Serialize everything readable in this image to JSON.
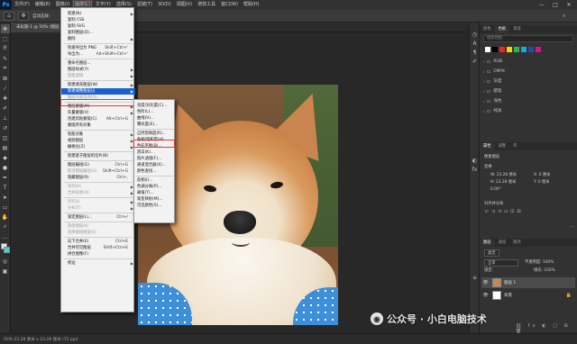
{
  "menubar": {
    "logo": "Ps",
    "items": [
      "文件(F)",
      "编辑(E)",
      "图像(I)",
      "图层(L)",
      "文字(Y)",
      "选择(S)",
      "滤镜(T)",
      "3D(D)",
      "视图(V)",
      "增效工具",
      "窗口(W)",
      "帮助(H)"
    ],
    "active_index": 3
  },
  "window_controls": {
    "minimize": "—",
    "maximize": "□",
    "close": "✕"
  },
  "options_bar": {
    "label": "自动选择："
  },
  "document_tab": {
    "label": "未标题-1 @ 50% (图层 1, RGB/8)"
  },
  "layer_menu": {
    "rows": [
      {
        "label": "新建(N)",
        "arrow": true
      },
      {
        "label": "复制 CSS"
      },
      {
        "label": "复制 SVG"
      },
      {
        "label": "复制图层(D)...",
        "disabled": false
      },
      {
        "label": "删除",
        "arrow": true
      },
      {
        "sep": true
      },
      {
        "label": "快速导出为 PNG",
        "shortcut": "Shift+Ctrl+'"
      },
      {
        "label": "导出为...",
        "shortcut": "Alt+Shift+Ctrl+'"
      },
      {
        "sep": true
      },
      {
        "label": "重命名图层..."
      },
      {
        "label": "图层样式(Y)",
        "arrow": true
      },
      {
        "label": "智能滤镜",
        "arrow": true,
        "disabled": true
      },
      {
        "sep": true
      },
      {
        "label": "新建填充图层(W)",
        "arrow": true
      },
      {
        "label": "新建调整图层(J)",
        "arrow": true,
        "highlight": true
      },
      {
        "label": "图层内容选项(O)...",
        "disabled": true
      },
      {
        "sep": true
      },
      {
        "label": "图层蒙版(M)",
        "arrow": true
      },
      {
        "label": "矢量蒙版(V)",
        "arrow": true
      },
      {
        "label": "创建剪贴蒙版(C)",
        "shortcut": "Alt+Ctrl+G"
      },
      {
        "label": "蒙版所有对象"
      },
      {
        "sep": true
      },
      {
        "label": "智能对象",
        "arrow": true
      },
      {
        "label": "视频图层",
        "arrow": true
      },
      {
        "label": "栅格化(Z)",
        "arrow": true
      },
      {
        "sep": true
      },
      {
        "label": "新建基于图层的切片(B)"
      },
      {
        "sep": true
      },
      {
        "label": "图层编组(G)",
        "shortcut": "Ctrl+G"
      },
      {
        "label": "取消图层编组(U)",
        "shortcut": "Shift+Ctrl+G",
        "disabled": true
      },
      {
        "label": "隐藏图层(R)",
        "shortcut": "Ctrl+,"
      },
      {
        "sep": true
      },
      {
        "label": "排列(A)",
        "arrow": true,
        "disabled": true
      },
      {
        "label": "合并形状(H)",
        "arrow": true,
        "disabled": true
      },
      {
        "sep": true
      },
      {
        "label": "对齐(I)",
        "arrow": true,
        "disabled": true
      },
      {
        "label": "分布(T)",
        "arrow": true,
        "disabled": true
      },
      {
        "sep": true
      },
      {
        "label": "锁定图层(L)...",
        "shortcut": "Ctrl+/"
      },
      {
        "sep": true
      },
      {
        "label": "链接图层(K)",
        "disabled": true
      },
      {
        "label": "选择链接图层(S)",
        "disabled": true
      },
      {
        "sep": true
      },
      {
        "label": "向下合并(E)",
        "shortcut": "Ctrl+E"
      },
      {
        "label": "合并可见图层",
        "shortcut": "Shift+Ctrl+E"
      },
      {
        "label": "拼合图像(F)"
      },
      {
        "sep": true
      },
      {
        "label": "修边",
        "arrow": true
      }
    ]
  },
  "adjust_submenu": {
    "rows": [
      {
        "label": "亮度/对比度(C)..."
      },
      {
        "label": "色阶(L)..."
      },
      {
        "label": "曲线(V)..."
      },
      {
        "label": "曝光度(E)..."
      },
      {
        "sep": true
      },
      {
        "label": "自然饱和度(R)..."
      },
      {
        "label": "色相/饱和度(H)...",
        "boxed": true
      },
      {
        "label": "色彩平衡(B)..."
      },
      {
        "label": "黑白(K)..."
      },
      {
        "label": "照片滤镜(F)..."
      },
      {
        "label": "通道混合器(X)..."
      },
      {
        "label": "颜色查找..."
      },
      {
        "sep": true
      },
      {
        "label": "反相(I)..."
      },
      {
        "label": "色调分离(P)..."
      },
      {
        "label": "阈值(T)..."
      },
      {
        "label": "渐变映射(M)..."
      },
      {
        "label": "可选颜色(S)..."
      }
    ]
  },
  "right_panel": {
    "top_tabs": [
      "颜色",
      "色板",
      "渐变"
    ],
    "swatch_search": "搜索色板",
    "swatch_colors": [
      "#ffffff",
      "#000000",
      "#e8262a",
      "#f5d400",
      "#2fb34a",
      "#1aa7df",
      "#2c47a5",
      "#d8148a"
    ],
    "folders": [
      "RGB",
      "CMYK",
      "灰度",
      "蜡笔",
      "浅色",
      "纯净"
    ],
    "props_tabs": [
      "属性",
      "调整",
      "库"
    ],
    "props_title": "像素图层",
    "transform_label": "变换",
    "w_value": "W: 23.28 厘米",
    "h_value": "H: 23.28 厘米",
    "x_value": "X: 0 厘米",
    "y_value": "Y: 0 厘米",
    "angle_value": "0.00°",
    "align_label": "对齐并分布",
    "layers_tabs": [
      "图层",
      "通道",
      "路径"
    ],
    "kind_label": "类型",
    "blend_mode": "正常",
    "opacity": "不透明度: 100%",
    "lock_label": "锁定:",
    "fill": "填充: 100%",
    "layers": [
      {
        "name": "图层 1",
        "selected": true
      },
      {
        "name": "背景",
        "selected": false
      }
    ]
  },
  "status": {
    "text": "50%   23.28 厘米 x 23.28 厘米 (72 ppi)"
  },
  "watermark": {
    "text": "公众号 · 小白电脑技术"
  }
}
